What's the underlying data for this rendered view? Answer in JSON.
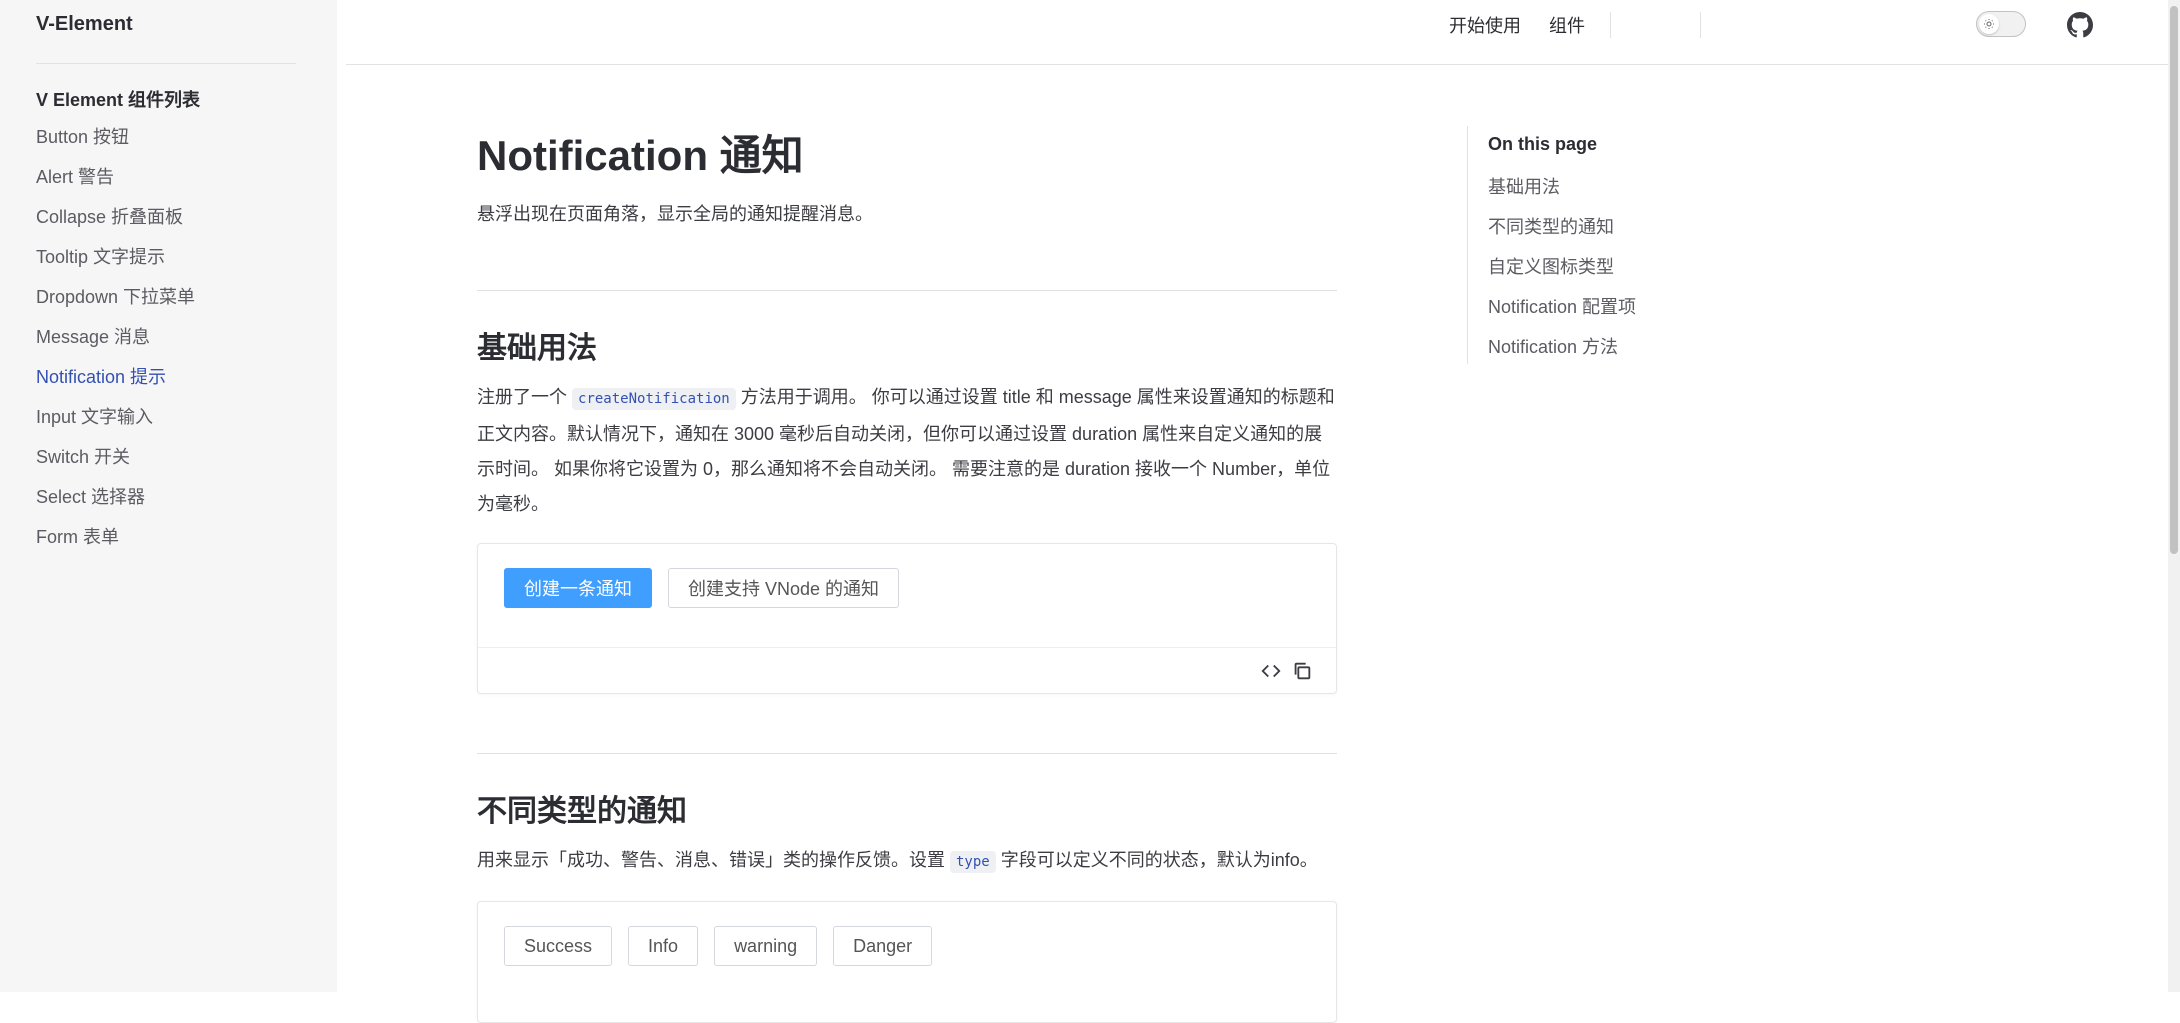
{
  "sidebar": {
    "brand": "V-Element",
    "section_title": "V Element 组件列表",
    "items": [
      {
        "label": "Button 按钮"
      },
      {
        "label": "Alert 警告"
      },
      {
        "label": "Collapse 折叠面板"
      },
      {
        "label": "Tooltip 文字提示"
      },
      {
        "label": "Dropdown 下拉菜单"
      },
      {
        "label": "Message 消息"
      },
      {
        "label": "Notification 提示"
      },
      {
        "label": "Input 文字输入"
      },
      {
        "label": "Switch 开关"
      },
      {
        "label": "Select 选择器"
      },
      {
        "label": "Form 表单"
      }
    ],
    "active_index": 6
  },
  "nav": {
    "getting_started": "开始使用",
    "components": "组件",
    "theme_icon": "sun-icon",
    "repo_icon": "github-icon"
  },
  "main": {
    "title": "Notification 通知",
    "lead": "悬浮出现在页面角落，显示全局的通知提醒消息。",
    "basic": {
      "heading": "基础用法",
      "p1": "注册了一个 ",
      "code": "createNotification",
      "p2": " 方法用于调用。 你可以通过设置 title 和 message 属性来设置通知的标题和正文内容。默认情况下，通知在 3000 毫秒后自动关闭，但你可以通过设置 duration 属性来自定义通知的展示时间。 如果你将它设置为 0，那么通知将不会自动关闭。 需要注意的是 duration 接收一个 Number，单位为毫秒。",
      "btn_create": "创建一条通知",
      "btn_vnode": "创建支持 VNode 的通知"
    },
    "types": {
      "heading": "不同类型的通知",
      "p1": "用来显示「成功、警告、消息、错误」类的操作反馈。设置 ",
      "code": "type",
      "p2": " 字段可以定义不同的状态，默认为info。",
      "buttons": [
        "Success",
        "Info",
        "warning",
        "Danger"
      ]
    }
  },
  "toc": {
    "title": "On this page",
    "items": [
      "基础用法",
      "不同类型的通知",
      "自定义图标类型",
      "Notification 配置项",
      "Notification 方法"
    ]
  },
  "colors": {
    "primary": "#409eff",
    "active_link": "#3451b2",
    "sidebar_bg": "#f6f6f7"
  }
}
